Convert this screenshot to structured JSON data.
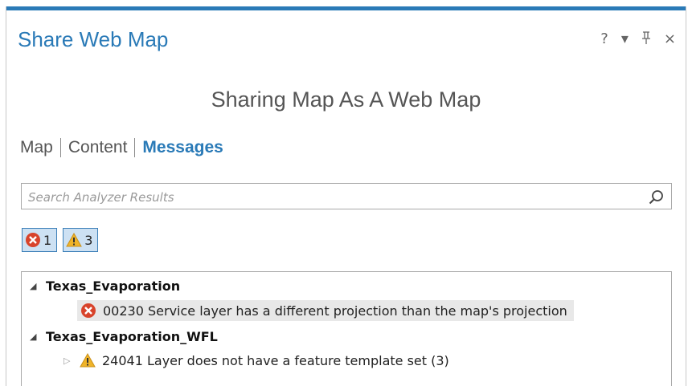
{
  "pane": {
    "title": "Share Web Map",
    "controls": {
      "help": "?",
      "menu": "▾",
      "pin": "ᵖ",
      "close": "×"
    }
  },
  "heading": "Sharing Map As A Web Map",
  "tabs": [
    {
      "label": "Map"
    },
    {
      "label": "Content"
    },
    {
      "label": "Messages",
      "active": true
    }
  ],
  "search": {
    "placeholder": "Search Analyzer Results",
    "value": ""
  },
  "filters": {
    "errors": "1",
    "warnings": "3"
  },
  "tree": {
    "groups": [
      {
        "label": "Texas_Evaporation",
        "message": "00230 Service layer has a different projection than the map's projection"
      },
      {
        "label": "Texas_Evaporation_WFL",
        "message": "24041 Layer does not have a feature template set (3)"
      }
    ]
  },
  "colors": {
    "accent": "#2a7ab7",
    "error": "#d8432b",
    "warning": "#f0b429"
  }
}
